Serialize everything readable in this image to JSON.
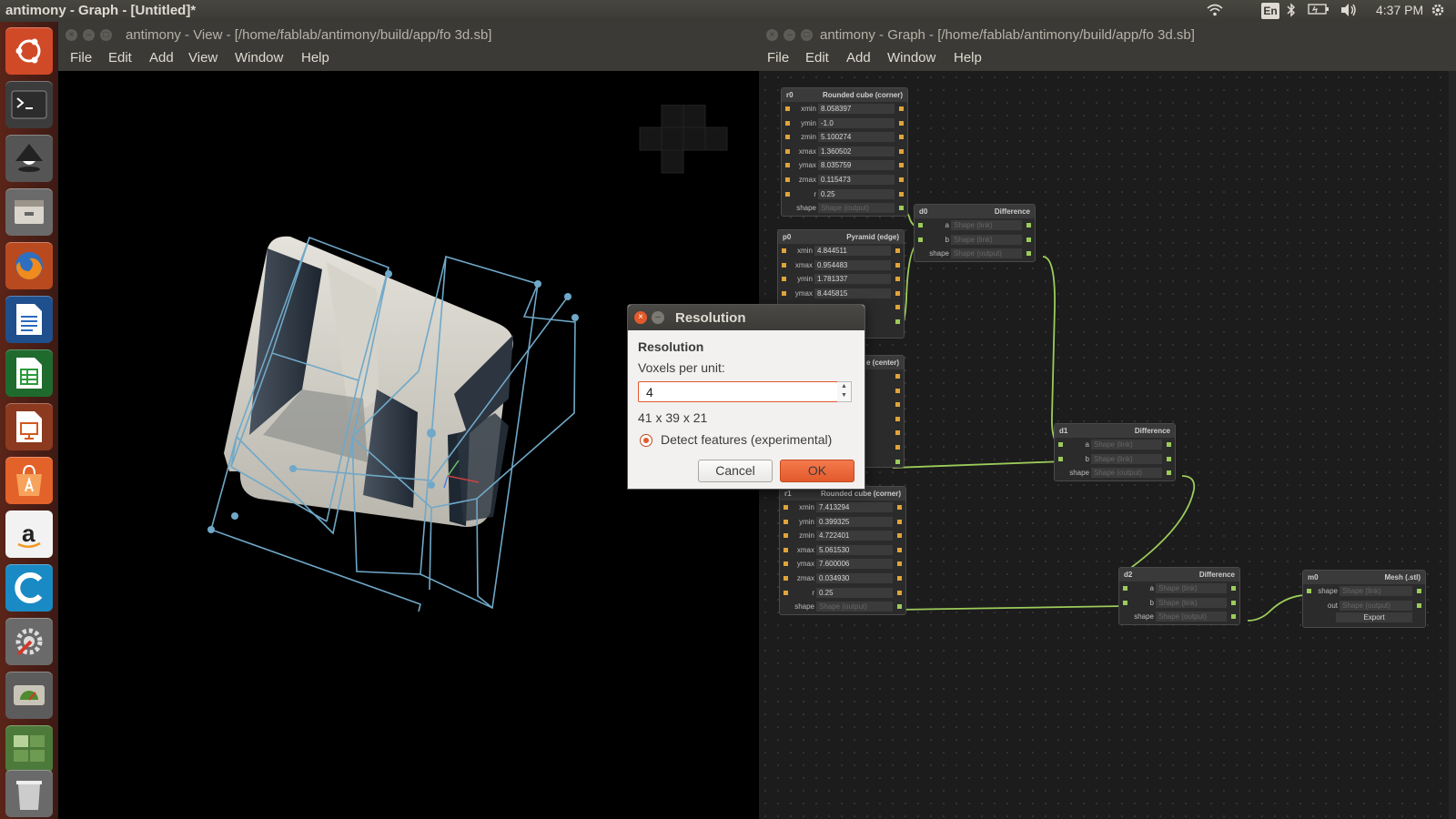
{
  "topbar": {
    "app_title": "antimony - Graph - [Untitled]*",
    "keyboard_layout": "En",
    "clock": "4:37 PM"
  },
  "launcher": {
    "items": [
      "ubuntu-dash-icon",
      "terminal-icon",
      "inkscape-icon",
      "file-manager-icon",
      "firefox-icon",
      "writer-icon",
      "calc-icon",
      "impress-icon",
      "software-center-icon",
      "amazon-icon",
      "browser-icon",
      "system-settings-icon",
      "disk-usage-icon",
      "workspace-switcher-icon",
      "trash-icon"
    ]
  },
  "view_window": {
    "title": "antimony - View - [/home/fablab/antimony/build/app/fo 3d.sb]",
    "menu": [
      "File",
      "Edit",
      "Add",
      "View",
      "Window",
      "Help"
    ]
  },
  "graph_window": {
    "title": "antimony - Graph - [/home/fablab/antimony/build/app/fo 3d.sb]",
    "menu": [
      "File",
      "Edit",
      "Add",
      "Window",
      "Help"
    ]
  },
  "nodes": {
    "r0": {
      "id": "r0",
      "type": "Rounded cube (corner)",
      "rows": [
        {
          "label": "xmin",
          "value": "8.058397"
        },
        {
          "label": "ymin",
          "value": "-1.0"
        },
        {
          "label": "zmin",
          "value": "5.100274"
        },
        {
          "label": "xmax",
          "value": "1.360502"
        },
        {
          "label": "ymax",
          "value": "8.035759"
        },
        {
          "label": "zmax",
          "value": "0.115473"
        },
        {
          "label": "r",
          "value": "0.25"
        },
        {
          "label": "shape",
          "value": "Shape (output)"
        }
      ]
    },
    "p0": {
      "id": "p0",
      "type": "Pyramid (edge)",
      "rows": [
        {
          "label": "xmin",
          "value": "4.844511"
        },
        {
          "label": "xmax",
          "value": "0.954483"
        },
        {
          "label": "ymin",
          "value": "1.781337"
        },
        {
          "label": "ymax",
          "value": "8.445815"
        }
      ]
    },
    "hidden_center": {
      "type": "e (center)"
    },
    "d0": {
      "id": "d0",
      "type": "Difference",
      "rows": [
        {
          "label": "a",
          "value": "Shape (link)"
        },
        {
          "label": "b",
          "value": "Shape (link)"
        },
        {
          "label": "shape",
          "value": "Shape (output)"
        }
      ]
    },
    "d1": {
      "id": "d1",
      "type": "Difference",
      "rows": [
        {
          "label": "a",
          "value": "Shape (link)"
        },
        {
          "label": "b",
          "value": "Shape (link)"
        },
        {
          "label": "shape",
          "value": "Shape (output)"
        }
      ]
    },
    "r1": {
      "id": "r1",
      "type": "Rounded cube (corner)",
      "rows": [
        {
          "label": "xmin",
          "value": "7.413294"
        },
        {
          "label": "ymin",
          "value": "0.399325"
        },
        {
          "label": "zmin",
          "value": "4.722401"
        },
        {
          "label": "xmax",
          "value": "5.061530"
        },
        {
          "label": "ymax",
          "value": "7.600006"
        },
        {
          "label": "zmax",
          "value": "0.034930"
        },
        {
          "label": "r",
          "value": "0.25"
        },
        {
          "label": "shape",
          "value": "Shape (output)"
        }
      ]
    },
    "d2": {
      "id": "d2",
      "type": "Difference",
      "rows": [
        {
          "label": "a",
          "value": "Shape (link)"
        },
        {
          "label": "b",
          "value": "Shape (link)"
        },
        {
          "label": "shape",
          "value": "Shape (output)"
        }
      ]
    },
    "m0": {
      "id": "m0",
      "type": "Mesh (.stl)",
      "rows": [
        {
          "label": "shape",
          "value": "Shape (link)"
        },
        {
          "label": "out",
          "value": "Shape (output)"
        }
      ],
      "export_label": "Export"
    }
  },
  "dialog": {
    "title": "Resolution",
    "heading": "Resolution",
    "voxels_label": "Voxels per unit:",
    "voxels_value": "4",
    "dimensions": "41 x 39 x 21",
    "detect_features_label": "Detect features (experimental)",
    "detect_features_checked": true,
    "cancel_label": "Cancel",
    "ok_label": "OK"
  },
  "colors": {
    "accent": "#e25a2b",
    "wire": "#9ccc5a",
    "port": "#e0a43a",
    "bbox": "#6fa8c8"
  }
}
